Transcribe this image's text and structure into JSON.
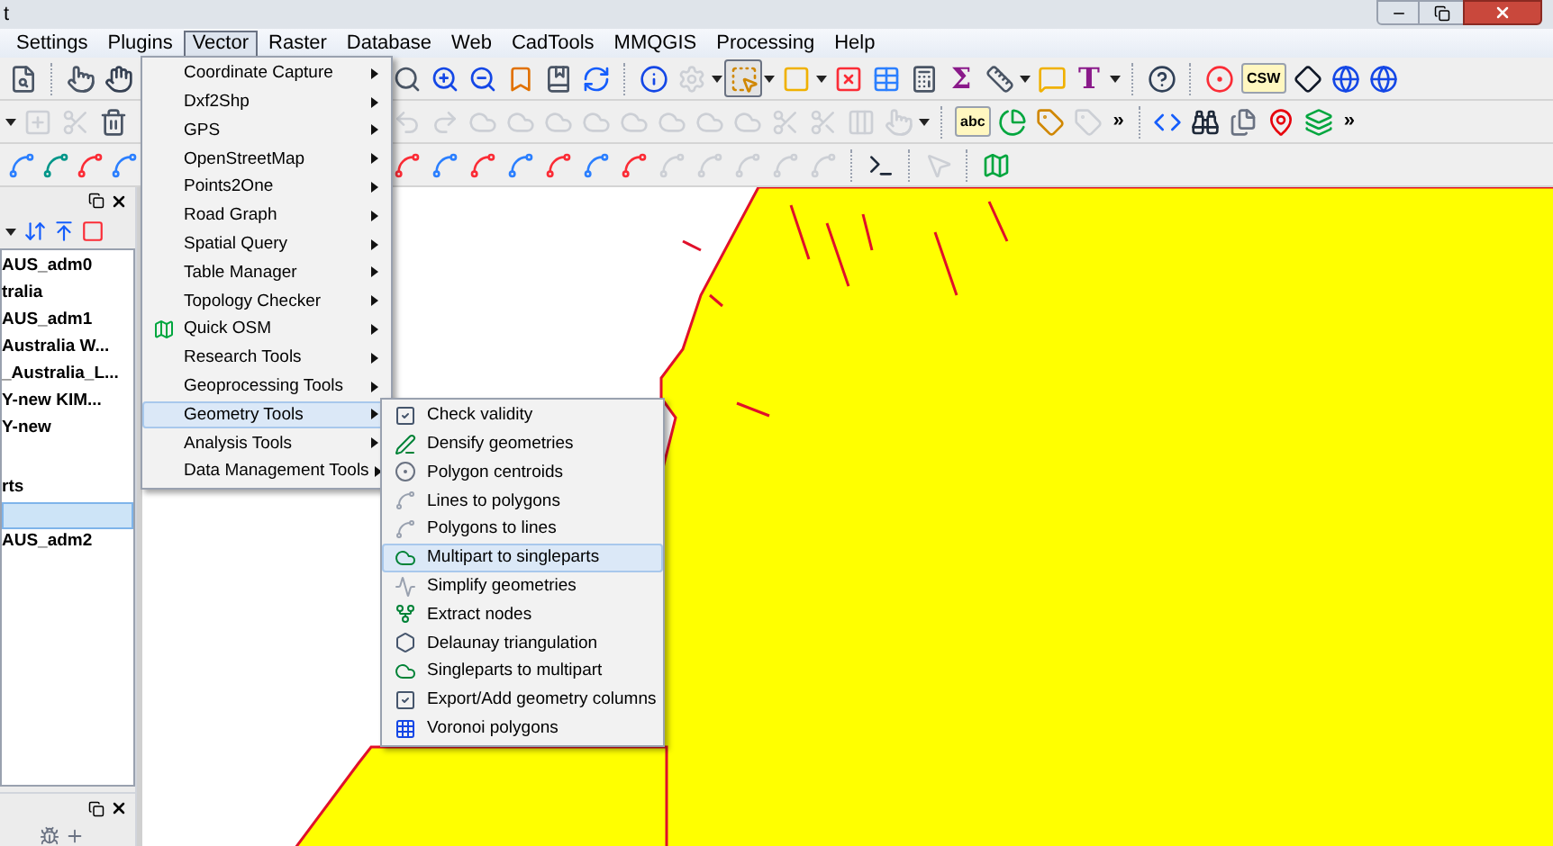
{
  "window": {
    "title": "t"
  },
  "menu_bar": [
    {
      "label": "Settings",
      "selected": false
    },
    {
      "label": "Plugins",
      "selected": false
    },
    {
      "label": "Vector",
      "selected": true
    },
    {
      "label": "Raster",
      "selected": false
    },
    {
      "label": "Database",
      "selected": false
    },
    {
      "label": "Web",
      "selected": false
    },
    {
      "label": "CadTools",
      "selected": false
    },
    {
      "label": "MMQGIS",
      "selected": false
    },
    {
      "label": "Processing",
      "selected": false
    },
    {
      "label": "Help",
      "selected": false
    }
  ],
  "toolbars": [
    {
      "left": [
        {
          "kind": "icon",
          "disabled": false,
          "pressed": false
        },
        {
          "kind": "sep"
        },
        {
          "kind": "icon",
          "disabled": false,
          "pressed": false
        },
        {
          "kind": "icon",
          "disabled": false,
          "pressed": false
        }
      ],
      "right": [
        {
          "kind": "icon",
          "disabled": false,
          "pressed": false
        },
        {
          "kind": "icon",
          "disabled": false,
          "pressed": false
        },
        {
          "kind": "icon",
          "disabled": false,
          "pressed": false
        },
        {
          "kind": "icon",
          "disabled": false,
          "pressed": false
        },
        {
          "kind": "icon",
          "disabled": false,
          "pressed": false
        },
        {
          "kind": "icon",
          "disabled": false,
          "pressed": false
        },
        {
          "kind": "sep"
        },
        {
          "kind": "icon",
          "disabled": false,
          "pressed": false
        },
        {
          "kind": "icon",
          "disabled": true,
          "pressed": false
        },
        {
          "kind": "caret"
        },
        {
          "kind": "icon",
          "disabled": false,
          "pressed": true
        },
        {
          "kind": "caret"
        },
        {
          "kind": "icon",
          "disabled": false,
          "pressed": false
        },
        {
          "kind": "caret"
        },
        {
          "kind": "icon",
          "disabled": false,
          "pressed": false
        },
        {
          "kind": "icon",
          "disabled": false,
          "pressed": false
        },
        {
          "kind": "icon",
          "disabled": false,
          "pressed": false
        },
        {
          "kind": "glyph",
          "text": "Σ"
        },
        {
          "kind": "icon",
          "disabled": false,
          "pressed": false
        },
        {
          "kind": "caret"
        },
        {
          "kind": "icon",
          "disabled": false,
          "pressed": false
        },
        {
          "kind": "glyph",
          "text": "T"
        },
        {
          "kind": "caret"
        },
        {
          "kind": "sep"
        },
        {
          "kind": "icon",
          "disabled": false,
          "pressed": false
        },
        {
          "kind": "sep"
        },
        {
          "kind": "icon",
          "disabled": false,
          "pressed": false
        },
        {
          "kind": "label",
          "text": "CSW"
        },
        {
          "kind": "icon",
          "disabled": false,
          "pressed": false
        },
        {
          "kind": "icon",
          "disabled": false,
          "pressed": false
        },
        {
          "kind": "icon",
          "disabled": false,
          "pressed": false
        }
      ]
    },
    {
      "left": [
        {
          "kind": "caret"
        },
        {
          "kind": "icon",
          "disabled": true,
          "pressed": false
        },
        {
          "kind": "icon",
          "disabled": true,
          "pressed": false
        },
        {
          "kind": "icon",
          "disabled": false,
          "pressed": false
        }
      ],
      "right": [
        {
          "kind": "icon",
          "disabled": true,
          "pressed": false
        },
        {
          "kind": "icon",
          "disabled": true,
          "pressed": false
        },
        {
          "kind": "icon",
          "disabled": true,
          "pressed": false
        },
        {
          "kind": "icon",
          "disabled": true,
          "pressed": false
        },
        {
          "kind": "icon",
          "disabled": true,
          "pressed": false
        },
        {
          "kind": "icon",
          "disabled": true,
          "pressed": false
        },
        {
          "kind": "icon",
          "disabled": true,
          "pressed": false
        },
        {
          "kind": "icon",
          "disabled": true,
          "pressed": false
        },
        {
          "kind": "icon",
          "disabled": true,
          "pressed": false
        },
        {
          "kind": "icon",
          "disabled": true,
          "pressed": false
        },
        {
          "kind": "icon",
          "disabled": true,
          "pressed": false
        },
        {
          "kind": "icon",
          "disabled": true,
          "pressed": false
        },
        {
          "kind": "icon",
          "disabled": true,
          "pressed": false
        },
        {
          "kind": "icon",
          "disabled": true,
          "pressed": false
        },
        {
          "kind": "caret"
        },
        {
          "kind": "sep"
        },
        {
          "kind": "label",
          "text": "abc"
        },
        {
          "kind": "icon",
          "disabled": false,
          "pressed": false
        },
        {
          "kind": "icon",
          "disabled": false,
          "pressed": false
        },
        {
          "kind": "icon",
          "disabled": true,
          "pressed": false
        },
        {
          "kind": "overflow",
          "text": "»"
        },
        {
          "kind": "sep"
        },
        {
          "kind": "icon",
          "disabled": false,
          "pressed": false
        },
        {
          "kind": "icon",
          "disabled": false,
          "pressed": false
        },
        {
          "kind": "icon",
          "disabled": false,
          "pressed": false
        },
        {
          "kind": "icon",
          "disabled": false,
          "pressed": false
        },
        {
          "kind": "icon",
          "disabled": false,
          "pressed": false
        },
        {
          "kind": "overflow",
          "text": "»"
        }
      ]
    },
    {
      "left": [
        {
          "kind": "icon",
          "disabled": false,
          "pressed": false
        },
        {
          "kind": "icon",
          "disabled": false,
          "pressed": false
        },
        {
          "kind": "icon",
          "disabled": false,
          "pressed": false
        },
        {
          "kind": "icon",
          "disabled": false,
          "pressed": false
        }
      ],
      "right": [
        {
          "kind": "icon",
          "disabled": false,
          "pressed": false
        },
        {
          "kind": "icon",
          "disabled": false,
          "pressed": false
        },
        {
          "kind": "icon",
          "disabled": false,
          "pressed": false
        },
        {
          "kind": "icon",
          "disabled": false,
          "pressed": false
        },
        {
          "kind": "icon",
          "disabled": false,
          "pressed": false
        },
        {
          "kind": "icon",
          "disabled": false,
          "pressed": false
        },
        {
          "kind": "icon",
          "disabled": false,
          "pressed": false
        },
        {
          "kind": "icon",
          "disabled": true,
          "pressed": false
        },
        {
          "kind": "icon",
          "disabled": true,
          "pressed": false
        },
        {
          "kind": "icon",
          "disabled": true,
          "pressed": false
        },
        {
          "kind": "icon",
          "disabled": true,
          "pressed": false
        },
        {
          "kind": "icon",
          "disabled": true,
          "pressed": false
        },
        {
          "kind": "sep"
        },
        {
          "kind": "icon",
          "disabled": false,
          "pressed": false
        },
        {
          "kind": "sep"
        },
        {
          "kind": "icon",
          "disabled": true,
          "pressed": false
        },
        {
          "kind": "sep"
        },
        {
          "kind": "icon",
          "disabled": false,
          "pressed": false
        }
      ]
    }
  ],
  "layers_panel": {
    "items": [
      {
        "text": "AUS_adm0",
        "selected": false
      },
      {
        "text": "tralia",
        "selected": false
      },
      {
        "text": "AUS_adm1",
        "selected": false
      },
      {
        "text": "Australia W...",
        "selected": false
      },
      {
        "text": "_Australia_L...",
        "selected": false
      },
      {
        "text": "Y-new KIM...",
        "selected": false
      },
      {
        "text": "Y-new",
        "selected": false
      },
      {
        "text": "rts",
        "selected": false
      },
      {
        "selected": true
      },
      {
        "text": "AUS_adm2",
        "selected": false
      }
    ]
  },
  "vector_menu": [
    {
      "label": "Coordinate Capture",
      "icon": false,
      "selected": false
    },
    {
      "label": "Dxf2Shp",
      "icon": false,
      "selected": false
    },
    {
      "label": "GPS",
      "icon": false,
      "selected": false
    },
    {
      "label": "OpenStreetMap",
      "icon": false,
      "selected": false
    },
    {
      "label": "Points2One",
      "icon": false,
      "selected": false
    },
    {
      "label": "Road Graph",
      "icon": false,
      "selected": false
    },
    {
      "label": "Spatial Query",
      "icon": false,
      "selected": false
    },
    {
      "label": "Table Manager",
      "icon": false,
      "selected": false
    },
    {
      "label": "Topology Checker",
      "icon": false,
      "selected": false
    },
    {
      "label": "Quick OSM",
      "icon": true,
      "selected": false
    },
    {
      "label": "Research Tools",
      "icon": false,
      "selected": false
    },
    {
      "label": "Geoprocessing Tools",
      "icon": false,
      "selected": false
    },
    {
      "label": "Geometry Tools",
      "icon": false,
      "selected": true
    },
    {
      "label": "Analysis Tools",
      "icon": false,
      "selected": false
    },
    {
      "label": "Data Management Tools",
      "icon": false,
      "selected": false
    }
  ],
  "geometry_tools_submenu": [
    {
      "label": "Check validity",
      "selected": false
    },
    {
      "label": "Densify geometries",
      "selected": false
    },
    {
      "label": "Polygon centroids",
      "selected": false
    },
    {
      "label": "Lines to polygons",
      "selected": false
    },
    {
      "label": "Polygons to lines",
      "selected": false
    },
    {
      "label": "Multipart to singleparts",
      "selected": true
    },
    {
      "label": "Simplify geometries",
      "selected": false
    },
    {
      "label": "Extract nodes",
      "selected": false
    },
    {
      "label": "Delaunay triangulation",
      "selected": false
    },
    {
      "label": "Singleparts to multipart",
      "selected": false
    },
    {
      "label": "Export/Add geometry columns",
      "selected": false
    },
    {
      "label": "Voronoi polygons",
      "selected": false
    }
  ]
}
